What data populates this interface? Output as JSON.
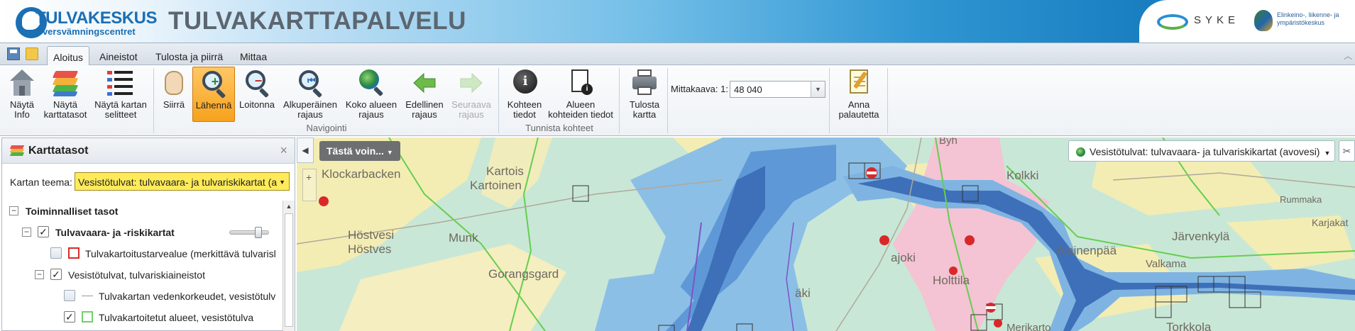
{
  "header": {
    "logo_main": "TULVAKESKUS",
    "logo_sub": "översvämningscentret",
    "app_title": "TULVAKARTTAPALVELU",
    "partner_syke": "SYKE",
    "partner_ely": "Elinkeino-, liikenne- ja ympäristökeskus"
  },
  "tabs": [
    {
      "label": "Aloitus"
    },
    {
      "label": "Aineistot"
    },
    {
      "label": "Tulosta ja piirrä"
    },
    {
      "label": "Mittaa"
    }
  ],
  "ribbon": {
    "buttons": {
      "info": "Näytä\nInfo",
      "layers": "Näytä\nkarttatasot",
      "legend": "Näytä kartan\nselitteet",
      "pan": "Siirrä",
      "zoom_in": "Lähennä",
      "zoom_out": "Loitonna",
      "original_extent": "Alkuperäinen\nrajaus",
      "full_extent": "Koko alueen\nrajaus",
      "previous_extent": "Edellinen\nrajaus",
      "next_extent": "Seuraava\nrajaus",
      "feature_info": "Kohteen\ntiedot",
      "area_feature_info": "Alueen\nkohteiden tiedot",
      "print_map": "Tulosta\nkartta",
      "feedback": "Anna\npalautetta"
    },
    "groups": {
      "navigation": "Navigointi",
      "identify": "Tunnista kohteet"
    },
    "scale_label": "Mittakaava: 1:",
    "scale_value": "48 040"
  },
  "panel": {
    "title": "Karttatasot",
    "close": "×",
    "theme_label": "Kartan teema:",
    "theme_value": "Vesistötulvat:  tulvavaara- ja tulvariskikartat (a",
    "tree": [
      {
        "label": "Toiminnalliset tasot"
      },
      {
        "label": "Tulvavaara- ja -riskikartat"
      },
      {
        "label": "Tulvakartoitustarvealue (merkittävä tulvarisl"
      },
      {
        "label": "Vesistötulvat, tulvariskiaineistot"
      },
      {
        "label": "Tulvakartan vedenkorkeudet, vesistötulv"
      },
      {
        "label": "Tulvakartoitetut alueet, vesistötulva"
      }
    ],
    "layer_opacity": 0.8
  },
  "map": {
    "tasto_button": "Tästä voin...",
    "layer_switch": "Vesistötulvat:  tulvavaara- ja tulvariskikartat (avovesi)",
    "places": [
      "Klockarbacken",
      "Kartois",
      "Kartoinen",
      "Höstvesi",
      "Höstves",
      "Munk",
      "Gorangsgard",
      "Kolkki",
      "Järvenkylä",
      "Rummaka",
      "Karjakat",
      "Alainenpää",
      "Valkama",
      "Holttila",
      "ajoki",
      "äki",
      "Torkkola",
      "Merikarto",
      "Byh"
    ]
  },
  "colors": {
    "zoom_active": "#f6a21c",
    "theme_highlight": "#ffeb5a",
    "flood_light": "#8bbde8",
    "flood_mid": "#5f98d6",
    "flood_dark": "#3d6fb8",
    "map_base": "#c8e6d8"
  }
}
